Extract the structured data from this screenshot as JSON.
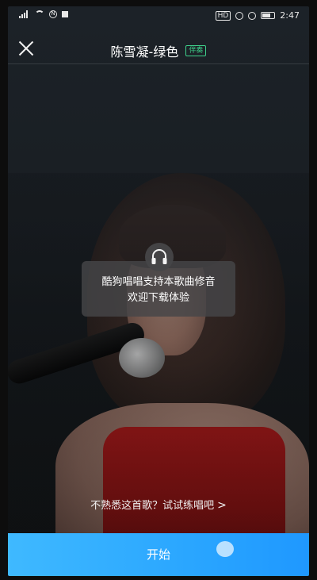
{
  "status_bar": {
    "left_indicators": [
      "signal-icon",
      "wifi-icon",
      "nfc-icon",
      "notification-icon"
    ],
    "right_indicators": [
      "hd-icon",
      "alarm-icon",
      "vibrate-icon",
      "battery-icon"
    ],
    "time": "2:47",
    "hd_label": "HD"
  },
  "header": {
    "title": "陈雪凝-绿色",
    "badge": "伴奏"
  },
  "toast": {
    "line1": "酷狗唱唱支持本歌曲修音",
    "line2": "欢迎下载体验"
  },
  "practice_link": {
    "label": "不熟悉这首歌？试试练唱吧",
    "chevron": ">"
  },
  "start_button": {
    "label": "开始"
  },
  "colors": {
    "accent": "#2aa6ff",
    "badge": "#3ed08a",
    "toast_bg": "#464648"
  }
}
